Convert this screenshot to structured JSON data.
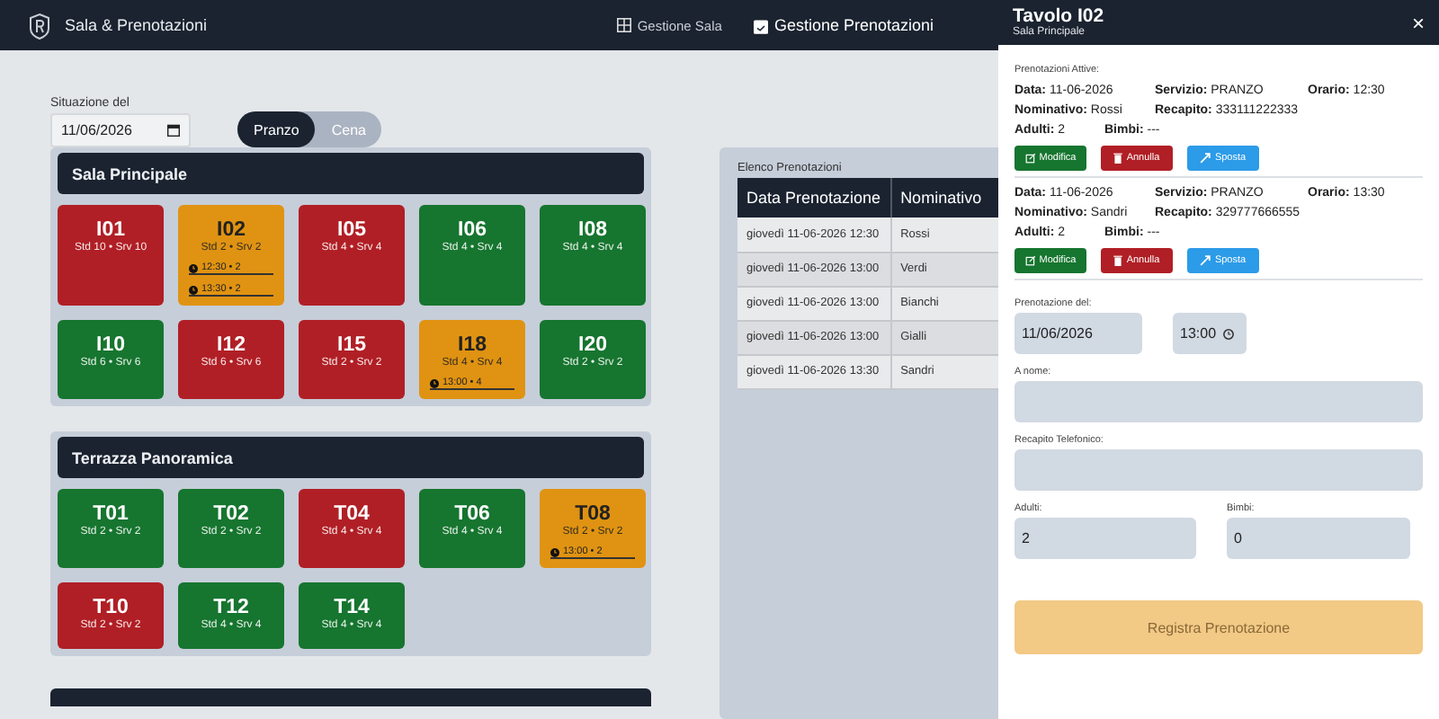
{
  "navbar": {
    "brand": "Sala & Prenotazioni",
    "links": [
      {
        "label": "Gestione Sala",
        "selected": false
      },
      {
        "label": "Gestione Prenotazioni",
        "selected": true
      }
    ]
  },
  "filters": {
    "date_label": "Situazione del",
    "date_value": "11/06/2026",
    "services": [
      {
        "label": "Pranzo",
        "selected": true
      },
      {
        "label": "Cena",
        "selected": false
      }
    ]
  },
  "sections": [
    {
      "title": "Sala Principale",
      "tables": [
        {
          "name": "I01",
          "seats": "Std 10 • Srv 10",
          "color": "#b01f25"
        },
        {
          "name": "I02",
          "seats": "Std 2 • Srv 2",
          "color": "#e09312",
          "reservations": [
            "12:30 • 2",
            "13:30 • 2"
          ]
        },
        {
          "name": "I05",
          "seats": "Std 4 • Srv 4",
          "color": "#b01f25"
        },
        {
          "name": "I06",
          "seats": "Std 4 • Srv 4",
          "color": "#16752f"
        },
        {
          "name": "I08",
          "seats": "Std 4 • Srv 4",
          "color": "#16752f"
        },
        {
          "name": "I10",
          "seats": "Std 6 • Srv 6",
          "color": "#16752f"
        },
        {
          "name": "I12",
          "seats": "Std 6 • Srv 6",
          "color": "#b01f25"
        },
        {
          "name": "I15",
          "seats": "Std 2 • Srv 2",
          "color": "#b01f25"
        },
        {
          "name": "I18",
          "seats": "Std 4 • Srv 4",
          "color": "#e09312",
          "reservations": [
            "13:00 • 4"
          ]
        },
        {
          "name": "I20",
          "seats": "Std 2 • Srv 2",
          "color": "#16752f"
        }
      ]
    },
    {
      "title": "Terrazza Panoramica",
      "tables": [
        {
          "name": "T01",
          "seats": "Std 2 • Srv 2",
          "color": "#16752f"
        },
        {
          "name": "T02",
          "seats": "Std 2 • Srv 2",
          "color": "#16752f"
        },
        {
          "name": "T04",
          "seats": "Std 4 • Srv 4",
          "color": "#b01f25"
        },
        {
          "name": "T06",
          "seats": "Std 4 • Srv 4",
          "color": "#16752f"
        },
        {
          "name": "T08",
          "seats": "Std 2 • Srv 2",
          "color": "#e09312",
          "reservations": [
            "13:00 • 2"
          ]
        },
        {
          "name": "T10",
          "seats": "Std 2 • Srv 2",
          "color": "#b01f25"
        },
        {
          "name": "T12",
          "seats": "Std 4 • Srv 4",
          "color": "#16752f"
        },
        {
          "name": "T14",
          "seats": "Std 4 • Srv 4",
          "color": "#16752f"
        }
      ]
    }
  ],
  "booking_list": {
    "title": "Elenco Prenotazioni",
    "columns": [
      "Data Prenotazione",
      "Nominativo"
    ],
    "rows": [
      [
        "giovedì 11-06-2026 12:30",
        "Rossi"
      ],
      [
        "giovedì 11-06-2026 13:00",
        "Verdi"
      ],
      [
        "giovedì 11-06-2026 13:00",
        "Bianchi"
      ],
      [
        "giovedì 11-06-2026 13:00",
        "Gialli"
      ],
      [
        "giovedì 11-06-2026 13:30",
        "Sandri"
      ]
    ]
  },
  "drawer": {
    "title": "Tavolo I02",
    "subtitle": "Sala Principale",
    "close": "×",
    "active_label": "Prenotazioni Attive:",
    "bookings": [
      {
        "actions": [
          {
            "label": "Modifica",
            "kind": "edit"
          },
          {
            "label": "Annulla",
            "kind": "delete"
          },
          {
            "label": "Sposta",
            "kind": "move"
          }
        ],
        "date_label": "Data:",
        "date": "11-06-2026",
        "service_label": "Servizio:",
        "service": "PRANZO",
        "time_label": "Orario:",
        "time": "12:30",
        "name_label": "Nominativo:",
        "name": "Rossi",
        "phone_label": "Recapito:",
        "phone": "333111222333",
        "adults_label": "Adulti:",
        "adults": "2",
        "kids_label": "Bimbi:",
        "kids": "---"
      },
      {
        "actions": [
          {
            "label": "Modifica",
            "kind": "edit"
          },
          {
            "label": "Annulla",
            "kind": "delete"
          },
          {
            "label": "Sposta",
            "kind": "move"
          }
        ],
        "date_label": "Data:",
        "date": "11-06-2026",
        "service_label": "Servizio:",
        "service": "PRANZO",
        "time_label": "Orario:",
        "time": "13:30",
        "name_label": "Nominativo:",
        "name": "Sandri",
        "phone_label": "Recapito:",
        "phone": "329777666555",
        "adults_label": "Adulti:",
        "adults": "2",
        "kids_label": "Bimbi:",
        "kids": "---"
      }
    ],
    "form": {
      "date_label": "Prenotazione del:",
      "date_value": "11/06/2026",
      "time_value": "13:00",
      "name_label": "A nome:",
      "phone_label": "Recapito Telefonico:",
      "adults_label": "Adulti:",
      "adults_value": "2",
      "kids_label": "Bimbi:",
      "kids_value": "0",
      "submit": "Registra Prenotazione",
      "submit_disabled": true
    }
  }
}
